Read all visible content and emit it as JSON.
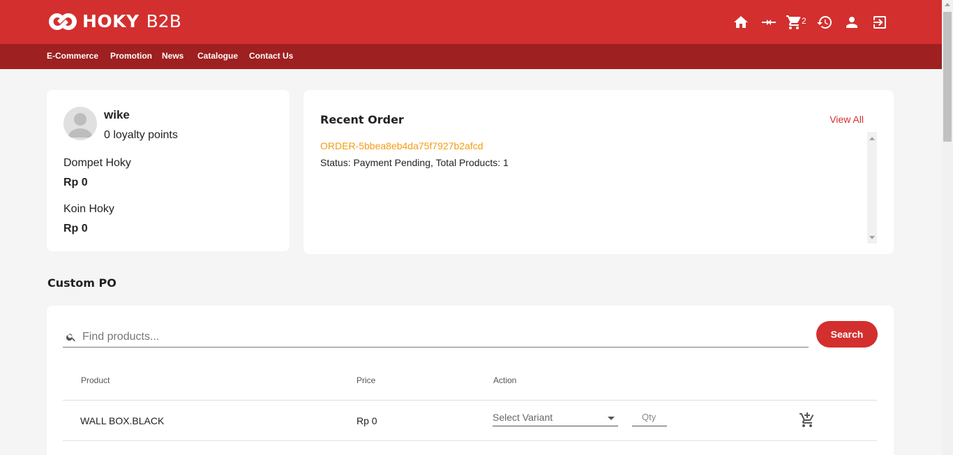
{
  "header": {
    "brand": "HOKY",
    "brand_suffix": "B2B",
    "cart_count": "2",
    "icons": [
      "home-icon",
      "compare-icon",
      "cart-icon",
      "history-icon",
      "account-icon",
      "logout-icon"
    ]
  },
  "nav": {
    "items": [
      {
        "label": "E-Commerce"
      },
      {
        "label": "Promotion"
      },
      {
        "label": "News"
      },
      {
        "label": "Catalogue"
      },
      {
        "label": "Contact Us"
      }
    ]
  },
  "profile": {
    "name": "wike",
    "loyalty": "0 loyalty points",
    "wallet_label": "Dompet Hoky",
    "wallet_value": "Rp 0",
    "coin_label": "Koin Hoky",
    "coin_value": "Rp 0"
  },
  "recent_order": {
    "title": "Recent Order",
    "view_all": "View All",
    "orders": [
      {
        "id": "ORDER-5bbea8eb4da75f7927b2afcd",
        "status": "Status: Payment Pending, Total Products: 1"
      }
    ]
  },
  "custom_po": {
    "title": "Custom PO",
    "search_placeholder": "Find products...",
    "search_button": "Search",
    "columns": {
      "product": "Product",
      "price": "Price",
      "action": "Action"
    },
    "rows": [
      {
        "product": "WALL BOX.BLACK",
        "price": "Rp 0",
        "variant_placeholder": "Select Variant",
        "qty_placeholder": "Qty"
      }
    ]
  },
  "colors": {
    "primary": "#d32f2f",
    "nav_bg": "#9e2020",
    "order_link": "#f39c12"
  }
}
